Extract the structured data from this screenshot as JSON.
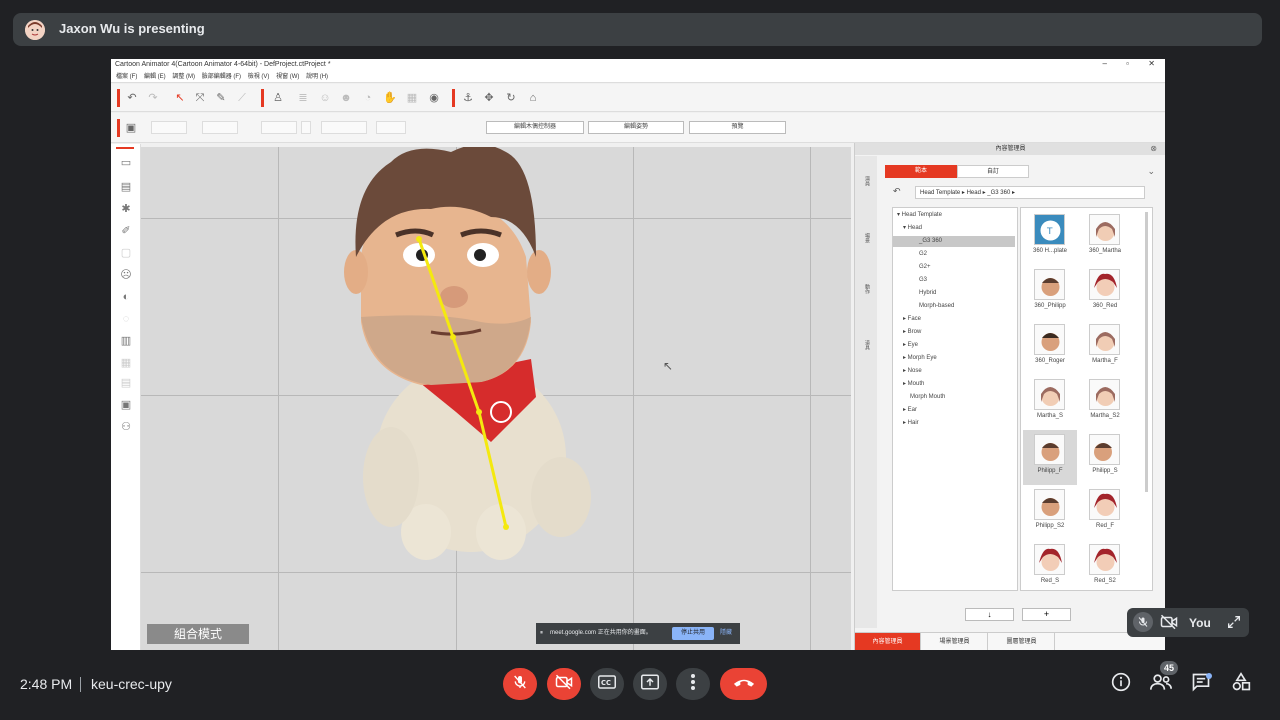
{
  "meet": {
    "presenting_text": "Jaxon Wu is presenting",
    "time": "2:48 PM",
    "meeting_code": "keu-crec-upy",
    "self_label": "You",
    "people_count": "45",
    "colors": {
      "end_call": "#ea4335",
      "bar": "#3c4043",
      "background": "#202124"
    }
  },
  "app": {
    "title": "Cartoon Animator 4(Cartoon Animator 4-64bit) - DefProject.ctProject *",
    "menu": [
      "檔案 (F)",
      "編輯 (E)",
      "調整 (M)",
      "臉部編輯器 (F)",
      "檢視 (V)",
      "視窗 (W)",
      "說明 (H)"
    ],
    "toolbar_buttons": [
      "編輯木偶控制器",
      "編輯姿勢",
      "預覽"
    ],
    "mode_label": "組合模式",
    "share_notice": {
      "text": "meet.google.com 正在共用你的畫面。",
      "stop": "停止共用",
      "hide": "隱藏"
    },
    "accent": "#e53922"
  },
  "content_manager": {
    "title": "內容管理員",
    "tabs": [
      "範本",
      "自訂"
    ],
    "side_tabs": [
      "演員",
      "場景",
      "動作",
      "道具"
    ],
    "breadcrumb": "Head Template ▸ Head ▸ _G3 360 ▸",
    "tree": [
      "▾ Head Template",
      "▾ Head",
      "_G3 360",
      "G2",
      "G2+",
      "G3",
      "Hybrid",
      "Morph-based",
      "▸ Face",
      "▸ Brow",
      "▸ Eye",
      "▸ Morph Eye",
      "▸ Nose",
      "▸ Mouth",
      "Morph Mouth",
      "▸ Ear",
      "▸ Hair"
    ],
    "thumbnails": [
      "360 H...plate",
      "360_Martha",
      "360_Philipp",
      "360_Red",
      "360_Roger",
      "Martha_F",
      "Martha_S",
      "Martha_S2",
      "Philipp_F",
      "Philipp_S",
      "Philipp_S2",
      "Red_F",
      "Red_S",
      "Red_S2"
    ],
    "bottom_tabs": [
      "內容管理員",
      "場景管理員",
      "圖層管理員"
    ]
  }
}
